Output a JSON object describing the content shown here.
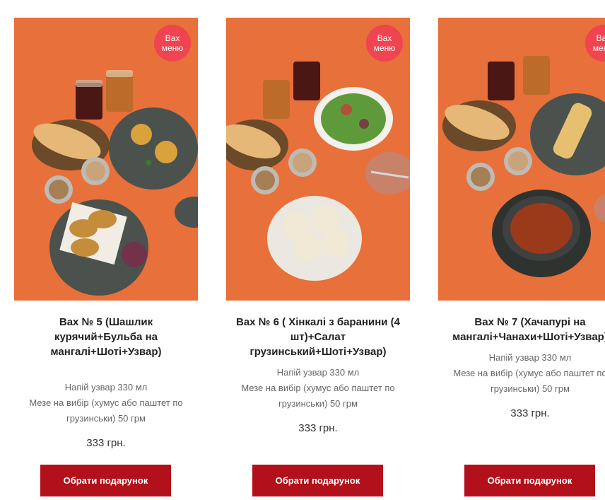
{
  "products": [
    {
      "badge_line1": "Вах",
      "badge_line2": "меню",
      "title": "Вах № 5 (Шашлик курячий+Бульба на мангалі+Шоті+Узвар)",
      "desc_line1": "Напій узвар 330 мл",
      "desc_line2": "Мезе на вибір (хумус або паштет по грузинськи) 50 грм",
      "price": "333 грн.",
      "button_label": "Обрати подарунок"
    },
    {
      "badge_line1": "Вах",
      "badge_line2": "меню",
      "title": "Вах № 6 ( Хінкалі з баранини (4 шт)+Салат грузинський+Шоті+Узвар)",
      "desc_line1": "Напій узвар 330 мл",
      "desc_line2": "Мезе на вибір (хумус або паштет по грузинськи) 50 грм",
      "price": "333 грн.",
      "button_label": "Обрати подарунок"
    },
    {
      "badge_line1": "Вах",
      "badge_line2": "меню",
      "title": "Вах № 7 (Хачапурі на мангалі+Чанахи+Шоті+Узвар)",
      "desc_line1": "Напій узвар 330 мл",
      "desc_line2": "Мезе на вибір (хумус або паштет по грузинськи) 50 грм",
      "price": "333 грн.",
      "button_label": "Обрати подарунок"
    }
  ],
  "colors": {
    "photo_bg": "#e8703a",
    "badge": "#f04451",
    "button": "#b2101a"
  }
}
